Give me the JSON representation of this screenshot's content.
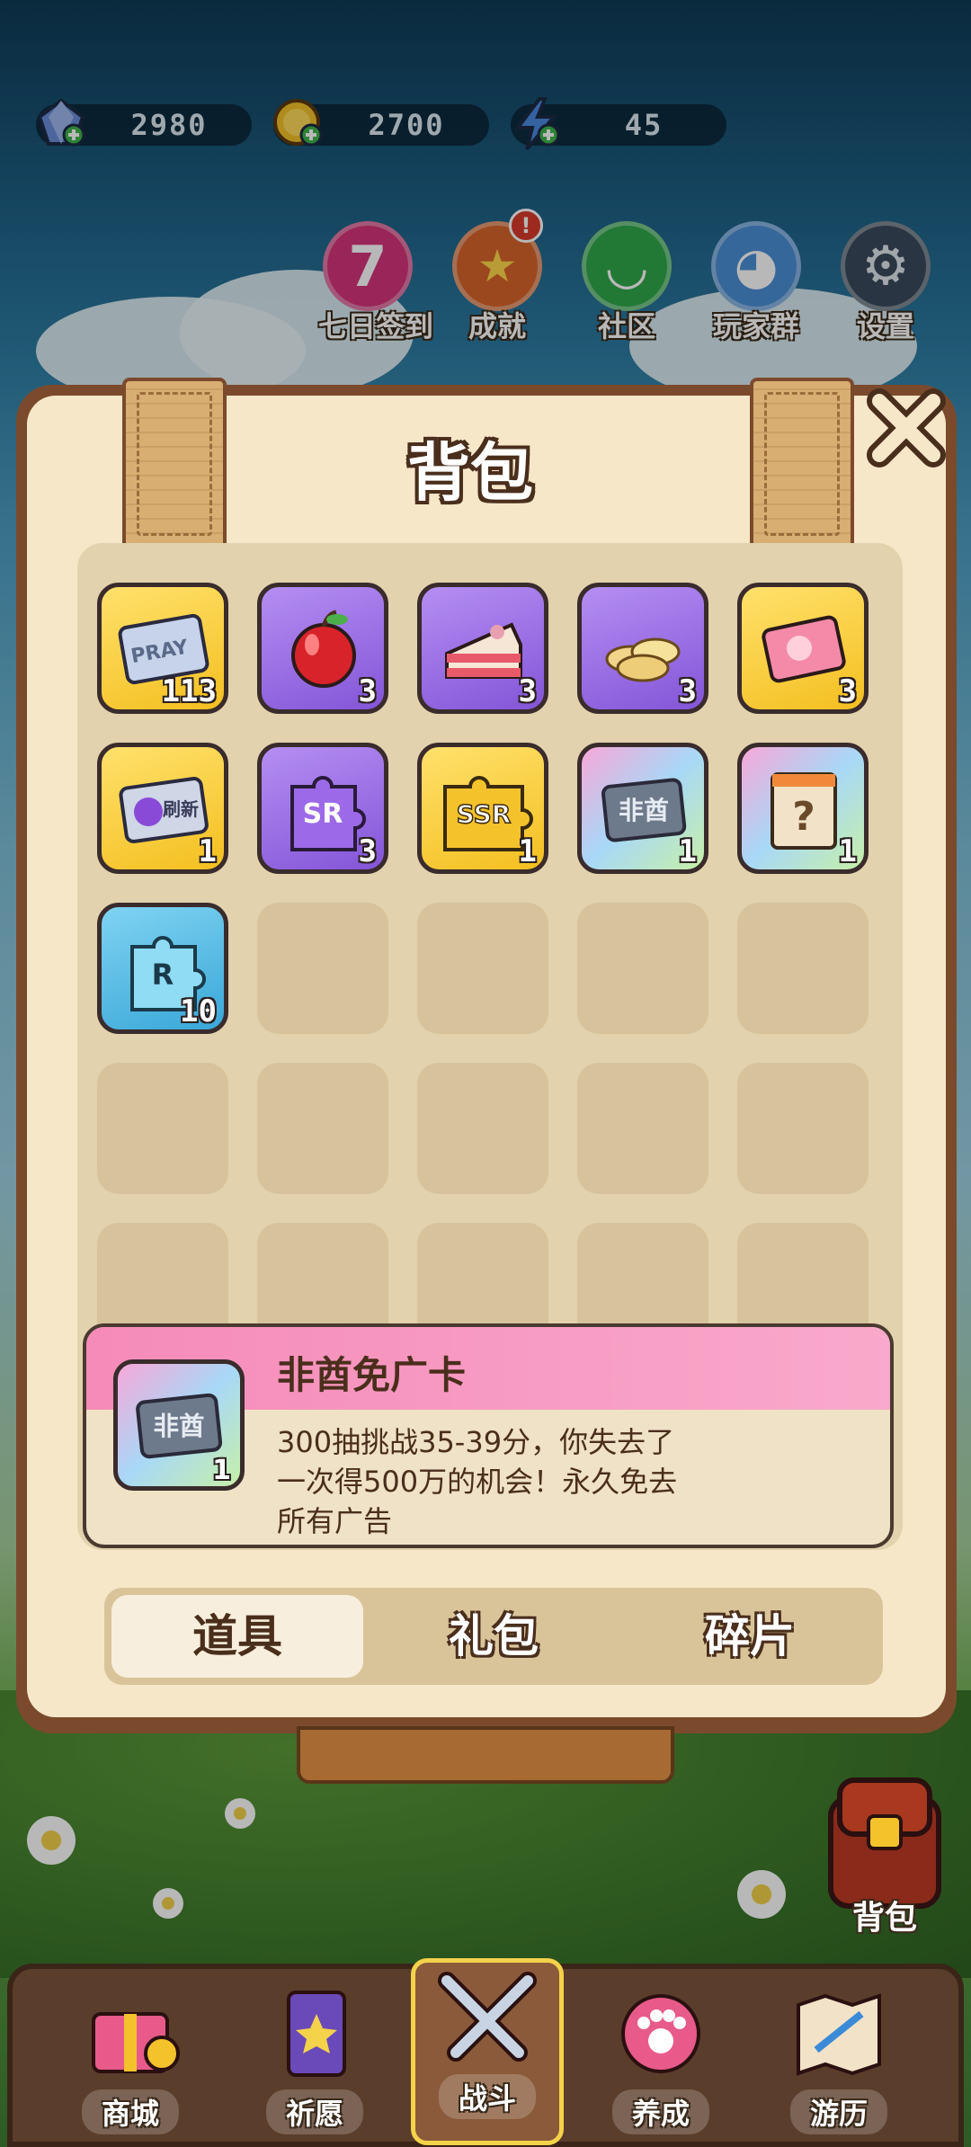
{
  "resources": [
    {
      "icon": "gem-icon",
      "value": "2980"
    },
    {
      "icon": "gold-coin-icon",
      "value": "2700"
    },
    {
      "icon": "energy-bolt-icon",
      "value": "45"
    }
  ],
  "top_buttons": [
    {
      "id": "checkin",
      "label": "七日签到",
      "glyph": "7",
      "color": "#d6347a"
    },
    {
      "id": "achievement",
      "label": "成就",
      "glyph": "★",
      "color": "#d9642a",
      "badge": "!"
    },
    {
      "id": "community",
      "label": "社区",
      "glyph": "◡",
      "color": "#2fa84a"
    },
    {
      "id": "player-group",
      "label": "玩家群",
      "glyph": "◕",
      "color": "#4b8fd6"
    },
    {
      "id": "settings",
      "label": "设置",
      "glyph": "⚙",
      "color": "#3a4a5c"
    }
  ],
  "backpack": {
    "title": "背包",
    "items": [
      {
        "name": "pray-ticket",
        "rarity": "gold",
        "qty": "113",
        "text": "PRAY"
      },
      {
        "name": "apple",
        "rarity": "purple",
        "qty": "3"
      },
      {
        "name": "cake-slice",
        "rarity": "purple",
        "qty": "3"
      },
      {
        "name": "chips",
        "rarity": "purple",
        "qty": "3"
      },
      {
        "name": "pink-ticket",
        "rarity": "gold",
        "qty": "3"
      },
      {
        "name": "refresh-card",
        "rarity": "gold",
        "qty": "1",
        "text": "刷新"
      },
      {
        "name": "sr-fragment",
        "rarity": "purple",
        "qty": "3",
        "text": "SR"
      },
      {
        "name": "ssr-fragment",
        "rarity": "gold",
        "qty": "1",
        "text": "SSR"
      },
      {
        "name": "feiyou-card",
        "rarity": "rainbow",
        "qty": "1",
        "text": "非酋"
      },
      {
        "name": "mystery-pack",
        "rarity": "rainbow",
        "qty": "1",
        "text": "?"
      },
      {
        "name": "r-fragment",
        "rarity": "blue",
        "qty": "10",
        "text": "R"
      }
    ],
    "detail": {
      "name": "非酋免广卡",
      "qty": "1",
      "thumb_text": "非酋",
      "description": "300抽挑战35-39分，你失去了一次得500万的机会！永久免去所有广告"
    },
    "tabs": [
      "道具",
      "礼包",
      "碎片"
    ],
    "active_tab": "道具"
  },
  "side_button": {
    "label": "背包"
  },
  "nav": [
    {
      "label": "商城"
    },
    {
      "label": "祈愿"
    },
    {
      "label": "战斗"
    },
    {
      "label": "养成"
    },
    {
      "label": "游历"
    }
  ]
}
